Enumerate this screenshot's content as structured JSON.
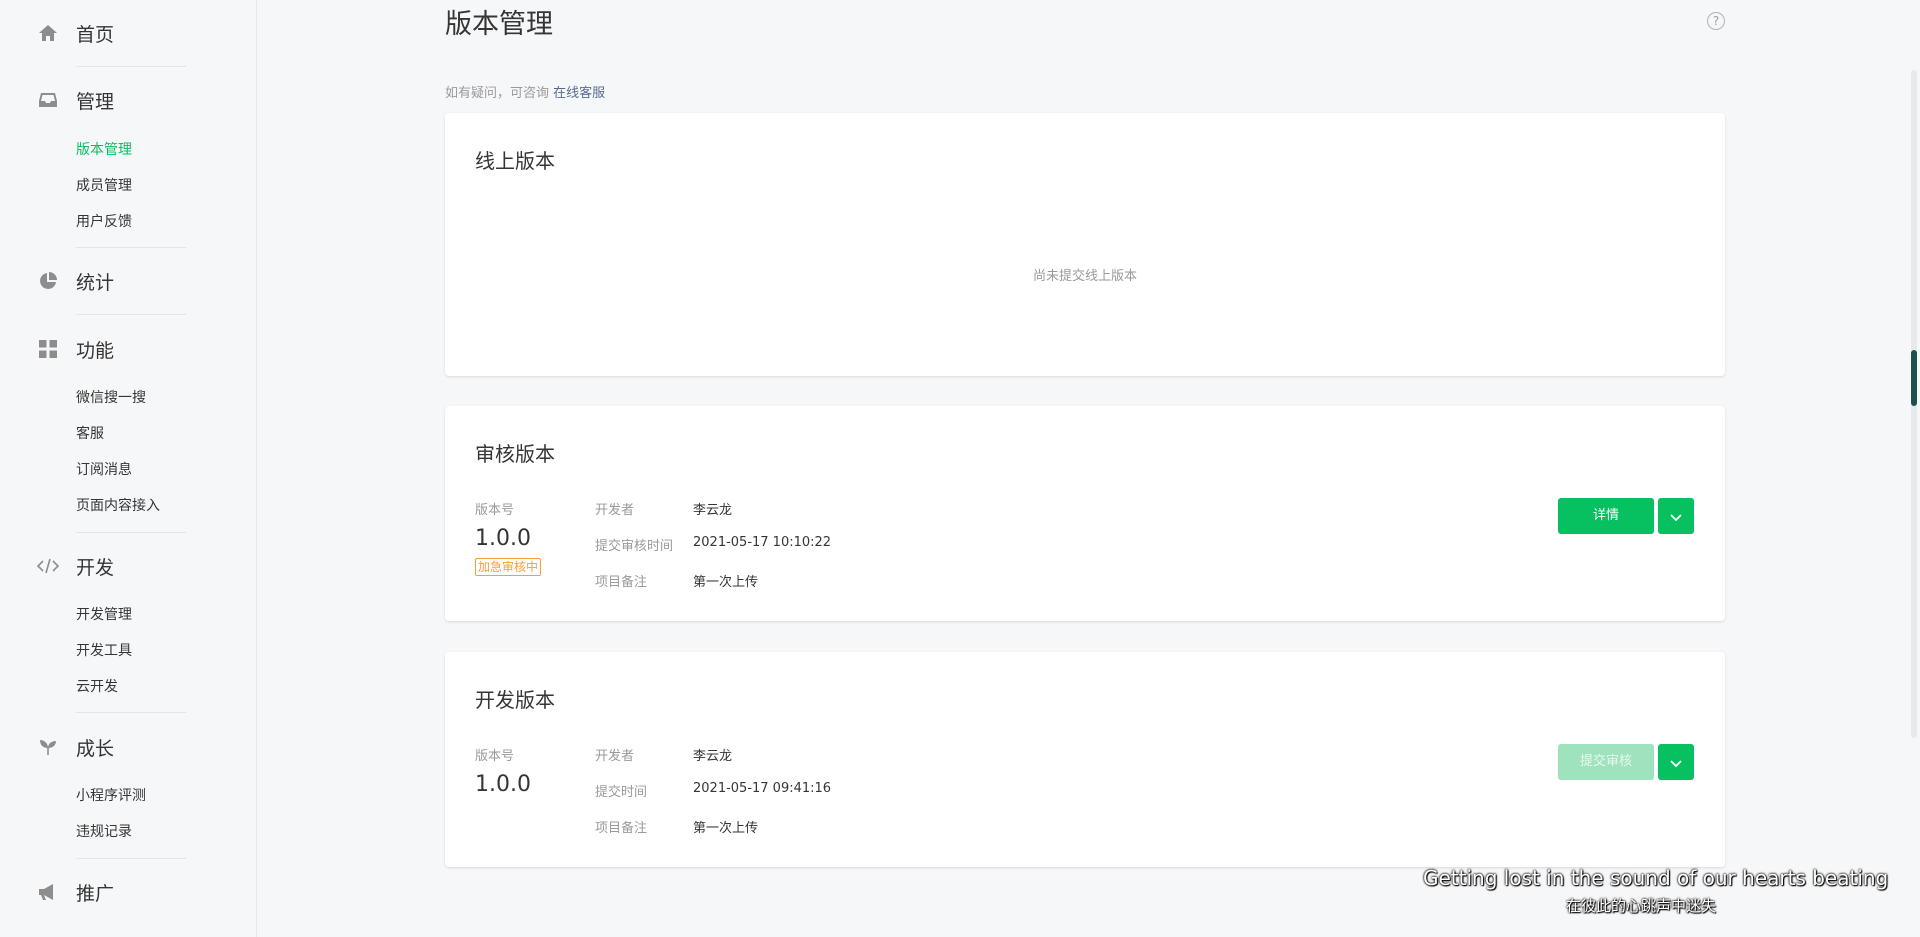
{
  "sidebar": {
    "home": {
      "label": "首页",
      "icon": "home-icon"
    },
    "manage": {
      "label": "管理",
      "icon": "inbox-icon",
      "items": [
        {
          "label": "版本管理",
          "active": true
        },
        {
          "label": "成员管理"
        },
        {
          "label": "用户反馈"
        }
      ]
    },
    "stats": {
      "label": "统计",
      "icon": "pie-chart-icon"
    },
    "features": {
      "label": "功能",
      "icon": "grid-icon",
      "items": [
        {
          "label": "微信搜一搜"
        },
        {
          "label": "客服"
        },
        {
          "label": "订阅消息"
        },
        {
          "label": "页面内容接入"
        }
      ]
    },
    "dev": {
      "label": "开发",
      "icon": "code-icon",
      "items": [
        {
          "label": "开发管理"
        },
        {
          "label": "开发工具"
        },
        {
          "label": "云开发"
        }
      ]
    },
    "growth": {
      "label": "成长",
      "icon": "sprout-icon",
      "items": [
        {
          "label": "小程序评测"
        },
        {
          "label": "违规记录"
        }
      ]
    },
    "promote": {
      "label": "推广",
      "icon": "megaphone-icon"
    }
  },
  "page": {
    "title": "版本管理",
    "help_icon": "?",
    "hint_text": "如有疑问，可咨询",
    "hint_link": "在线客服"
  },
  "online_version": {
    "title": "线上版本",
    "empty_text": "尚未提交线上版本"
  },
  "review_version": {
    "title": "审核版本",
    "version_label": "版本号",
    "version": "1.0.0",
    "badge": "加急审核中",
    "rows": [
      {
        "key": "开发者",
        "value": "李云龙"
      },
      {
        "key": "提交审核时间",
        "value": "2021-05-17 10:10:22"
      },
      {
        "key": "项目备注",
        "value": "第一次上传"
      }
    ],
    "primary_button": "详情"
  },
  "dev_version": {
    "title": "开发版本",
    "version_label": "版本号",
    "version": "1.0.0",
    "rows": [
      {
        "key": "开发者",
        "value": "李云龙"
      },
      {
        "key": "提交时间",
        "value": "2021-05-17 09:41:16"
      },
      {
        "key": "项目备注",
        "value": "第一次上传"
      }
    ],
    "primary_button": "提交审核",
    "primary_disabled": true
  },
  "subtitles": {
    "en": "Getting lost in the sound of our hearts beating",
    "cn": "在彼此的心跳声中迷失"
  },
  "colors": {
    "accent": "#07c160",
    "link": "#576b95",
    "badge": "#fa9d3b"
  }
}
